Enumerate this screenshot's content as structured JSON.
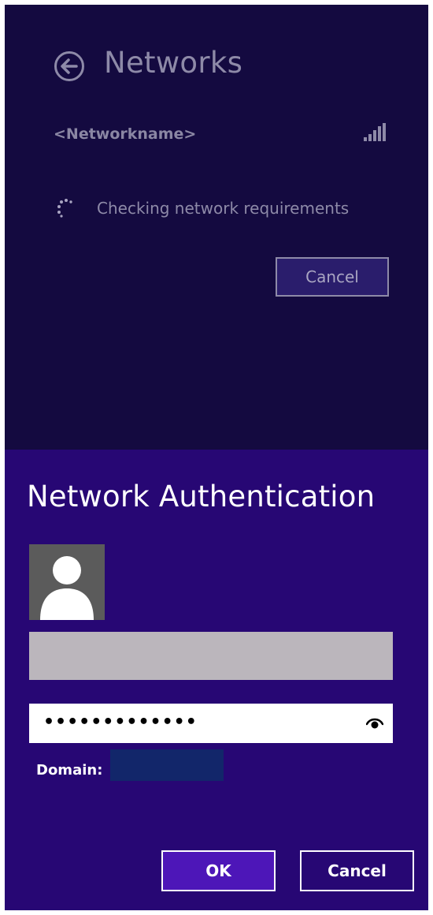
{
  "networks_pane": {
    "title": "Networks",
    "back_icon": "back-arrow-circle-icon",
    "network_name": "<Networkname>",
    "signal_icon": "signal-strength-icon",
    "status_icon": "loading-spinner-icon",
    "status_text": "Checking network requirements",
    "cancel_label": "Cancel",
    "background": "#140a40"
  },
  "auth_pane": {
    "title": "Network Authentication",
    "avatar_icon": "user-silhouette-icon",
    "username_value": "",
    "password_value": "•••••••••••••",
    "reveal_icon": "eye-reveal-icon",
    "domain_label": "Domain:",
    "domain_value": "",
    "ok_label": "OK",
    "cancel_label": "Cancel",
    "background": "#270774",
    "accent": "#4d16b8"
  }
}
